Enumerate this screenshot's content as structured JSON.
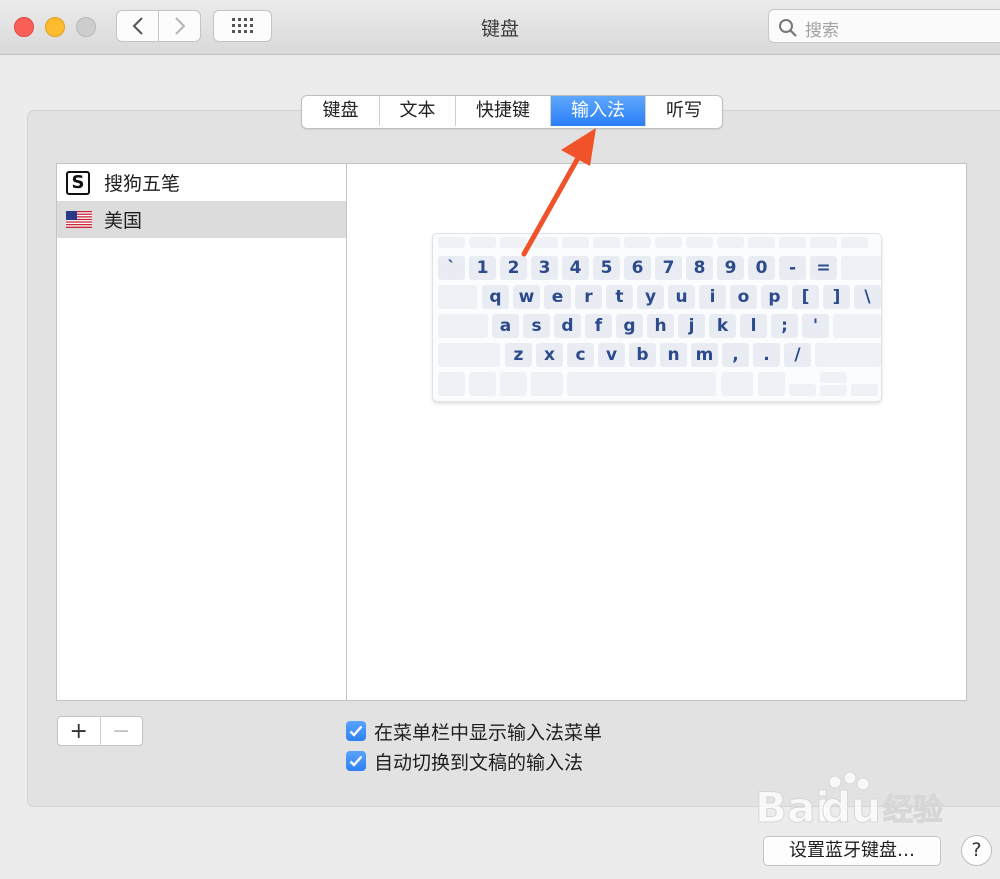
{
  "window": {
    "title": "键盘"
  },
  "search": {
    "placeholder": "搜索"
  },
  "tabs": [
    {
      "label": "键盘",
      "active": false
    },
    {
      "label": "文本",
      "active": false
    },
    {
      "label": "快捷键",
      "active": false
    },
    {
      "label": "输入法",
      "active": true
    },
    {
      "label": "听写",
      "active": false
    }
  ],
  "input_sources": [
    {
      "label": "搜狗五笔",
      "icon": "sogou-icon",
      "selected": false
    },
    {
      "label": "美国",
      "icon": "us-flag-icon",
      "selected": true
    }
  ],
  "keyboard": {
    "row1": [
      "`",
      "1",
      "2",
      "3",
      "4",
      "5",
      "6",
      "7",
      "8",
      "9",
      "0",
      "-",
      "="
    ],
    "row2": [
      "q",
      "w",
      "e",
      "r",
      "t",
      "y",
      "u",
      "i",
      "o",
      "p",
      "[",
      "]",
      "\\"
    ],
    "row3": [
      "a",
      "s",
      "d",
      "f",
      "g",
      "h",
      "j",
      "k",
      "l",
      ";",
      "'"
    ],
    "row4": [
      "z",
      "x",
      "c",
      "v",
      "b",
      "n",
      "m",
      ",",
      ".",
      "/"
    ]
  },
  "controls": {
    "add_label": "+",
    "remove_label": "−"
  },
  "checkboxes": [
    {
      "label": "在菜单栏中显示输入法菜单",
      "checked": true
    },
    {
      "label": "自动切换到文稿的输入法",
      "checked": true
    }
  ],
  "buttons": {
    "bluetooth_keyboard": "设置蓝牙键盘…",
    "help": "?"
  },
  "colors": {
    "accent": "#2d80f6",
    "key_text": "#2d4a8c",
    "arrow": "#f0532a"
  }
}
